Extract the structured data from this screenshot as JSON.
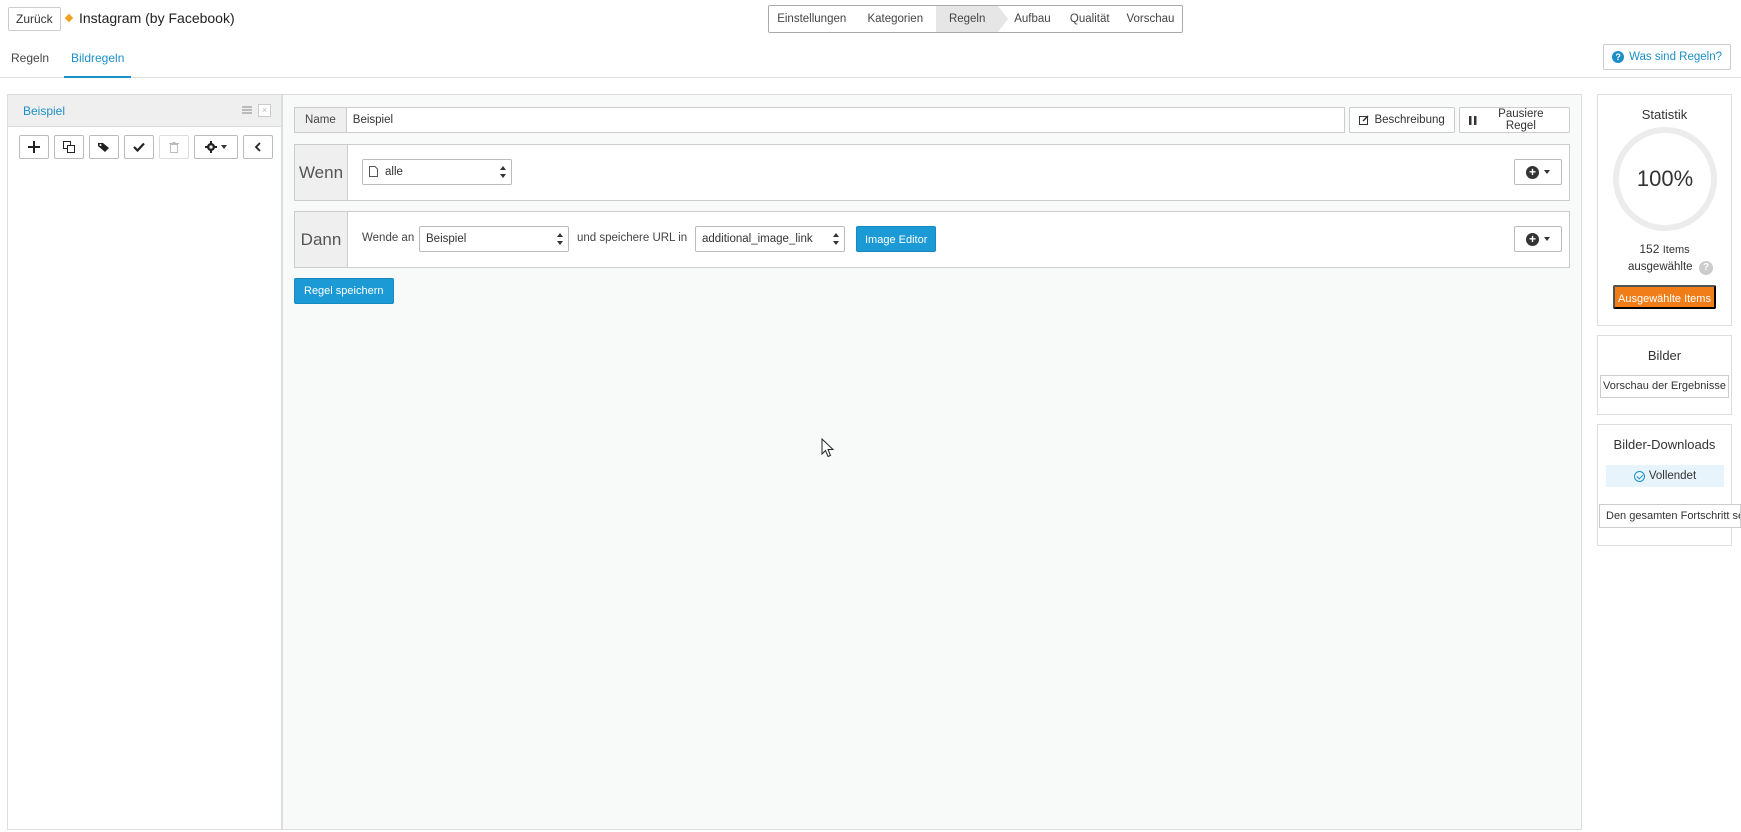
{
  "header": {
    "back_label": "Zurück",
    "app_title": "Instagram (by Facebook)"
  },
  "wizard": {
    "steps": [
      {
        "label": "Einstellungen",
        "active": false
      },
      {
        "label": "Kategorien",
        "active": false
      },
      {
        "label": "Regeln",
        "active": true
      },
      {
        "label": "Aufbau",
        "active": false
      },
      {
        "label": "Qualität",
        "active": false
      },
      {
        "label": "Vorschau",
        "active": false
      }
    ]
  },
  "subtabs": {
    "items": [
      {
        "label": "Regeln",
        "active": false
      },
      {
        "label": "Bildregeln",
        "active": true
      }
    ],
    "help_label": "Was sind Regeln?"
  },
  "rules_list": {
    "items": [
      {
        "label": "Beispiel"
      }
    ],
    "toolbar": [
      "plus-icon",
      "copy-icon",
      "tags-icon",
      "check-icon",
      "trash-icon",
      "gear-icon",
      "chevron-left-icon"
    ]
  },
  "editor": {
    "name_label": "Name",
    "name_value": "Beispiel",
    "description_label": "Beschreibung",
    "pause_label": "Pausiere Regel",
    "when": {
      "label": "Wenn",
      "select_value": "alle"
    },
    "then": {
      "label": "Dann",
      "apply_text": "Wende an",
      "apply_select": "Beispiel",
      "save_url_text": "und speichere URL in",
      "url_field_select": "additional_image_link",
      "image_editor_label": "Image Editor"
    },
    "save_label": "Regel speichern"
  },
  "stats": {
    "title": "Statistik",
    "percent": "100%",
    "items_count": "152",
    "items_word": "Items",
    "selected_label": "ausgewählte",
    "selected_button": "Ausgewählte Items"
  },
  "images": {
    "title": "Bilder",
    "preview_label": "Vorschau der Ergebnisse"
  },
  "downloads": {
    "title": "Bilder-Downloads",
    "status": "Vollendet",
    "progress_label": "Den gesamten Fortschritt seh"
  },
  "colors": {
    "accent": "#1b9ad6",
    "orange": "#f07d17"
  }
}
